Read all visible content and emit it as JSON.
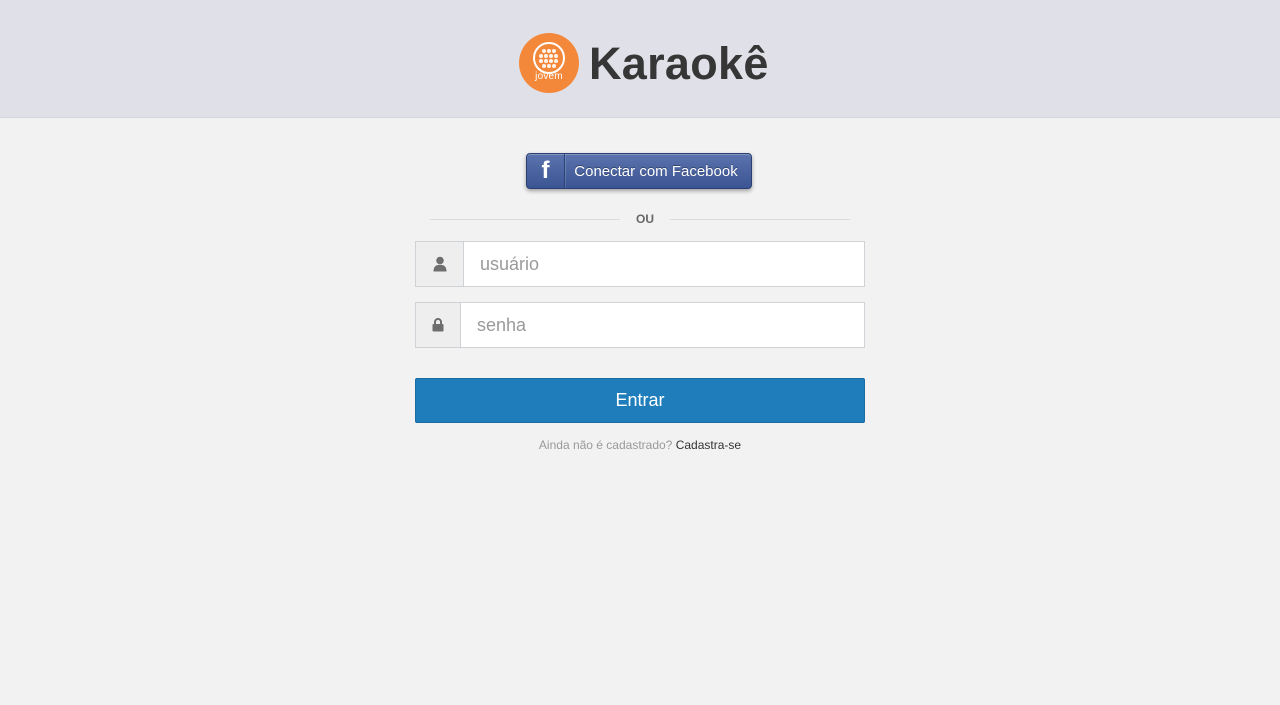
{
  "header": {
    "logo_text": "jovem",
    "title": "Karaokê",
    "brand_color": "#f4883a"
  },
  "login": {
    "facebook_icon": "f",
    "facebook_label": "Conectar com  Facebook",
    "divider": "OU",
    "username_placeholder": "usuário",
    "username_value": "",
    "password_placeholder": "senha",
    "password_value": "",
    "submit_label": "Entrar",
    "signup_prompt": "Ainda não é cadastrado?",
    "signup_link": "Cadastra-se",
    "primary_color": "#1f7dbb",
    "facebook_color": "#3b5594"
  },
  "icons": {
    "username": "user-icon",
    "password": "lock-icon"
  }
}
